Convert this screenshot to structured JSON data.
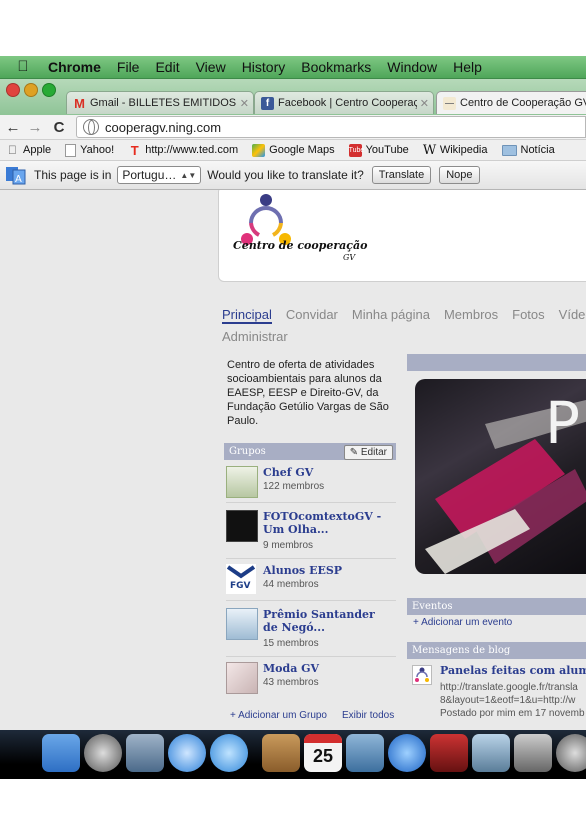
{
  "menubar": {
    "app": "Chrome",
    "items": [
      "File",
      "Edit",
      "View",
      "History",
      "Bookmarks",
      "Window",
      "Help"
    ]
  },
  "tabs": [
    {
      "label": "Gmail - BILLETES EMITIDOS:",
      "icon": "gmail-icon",
      "active": false
    },
    {
      "label": "Facebook | Centro Cooperaç",
      "icon": "facebook-icon",
      "active": false
    },
    {
      "label": "Centro de Cooperação GV",
      "icon": "ning-icon",
      "active": true
    }
  ],
  "toolbar": {
    "url": "cooperagv.ning.com"
  },
  "bookmarks": [
    {
      "label": "Apple",
      "icon": "apple-icon"
    },
    {
      "label": "Yahoo!",
      "icon": "page-icon"
    },
    {
      "label": "http://www.ted.com",
      "icon": "ted-icon"
    },
    {
      "label": "Google Maps",
      "icon": "maps-icon"
    },
    {
      "label": "YouTube",
      "icon": "youtube-icon"
    },
    {
      "label": "Wikipedia",
      "icon": "wikipedia-icon"
    },
    {
      "label": "Notícia",
      "icon": "folder-icon"
    }
  ],
  "translate": {
    "prefix": "This page is in",
    "language": "Portugu…",
    "question": "Would you like to translate it?",
    "translate_btn": "Translate",
    "nope_btn": "Nope"
  },
  "site": {
    "logo_text": "Centro de cooperação",
    "logo_sub": "GV",
    "nav": [
      "Principal",
      "Convidar",
      "Minha página",
      "Membros",
      "Fotos",
      "Vídeos",
      "Administrar"
    ],
    "description": "Centro de oferta de atividades socioambientais para alunos da EAESP, EESP e Direito-GV, da Fundação Getúlio Vargas de São Paulo.",
    "groups_title": "Grupos",
    "edit_label": "Editar",
    "groups": [
      {
        "name": "Chef GV",
        "members": "122 membros"
      },
      {
        "name": "FOTOcomtextoGV - Um Olha...",
        "members": "9 membros"
      },
      {
        "name": "Alunos EESP",
        "members": "44 membros"
      },
      {
        "name": "Prêmio Santander de Negó...",
        "members": "15 membros"
      },
      {
        "name": "Moda GV",
        "members": "43 membros"
      }
    ],
    "add_group": "+ Adicionar um Grupo",
    "show_all": "Exibir todos",
    "hero_letter": "P",
    "events_title": "Eventos",
    "add_event": "+ Adicionar um evento",
    "blog_title": "Mensagens de blog",
    "blog_post_title": "Panelas feitas com alumínio",
    "blog_line1": "http://translate.google.fr/transla",
    "blog_line2": "8&layout=1&eotf=1&u=http://w",
    "blog_line3": "Postado por mim em 17 novemb"
  },
  "dock": {
    "calendar_day": "25"
  },
  "colors": {
    "menubar": "#5fb568",
    "link": "#2b3d8f",
    "box_header": "#a8aec4"
  }
}
